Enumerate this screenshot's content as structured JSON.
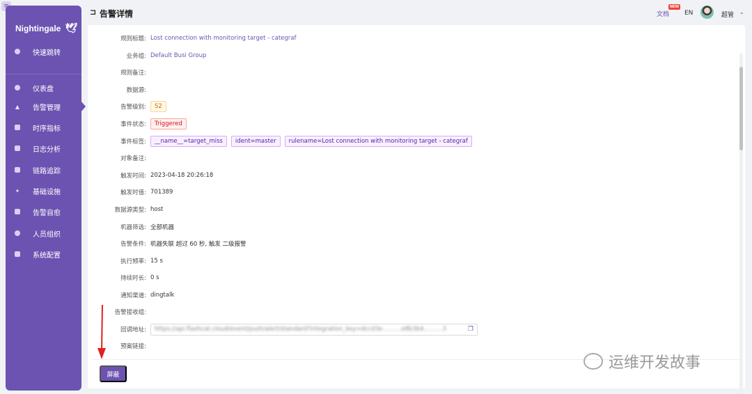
{
  "brand": {
    "name": "Nightingale"
  },
  "sidebar": {
    "items": [
      {
        "label": "快速跳转",
        "icon": "search-icon"
      },
      {
        "label": "仪表盘",
        "icon": "dashboard-icon"
      },
      {
        "label": "告警管理",
        "icon": "alarm-bell-icon",
        "active": true
      },
      {
        "label": "时序指标",
        "icon": "chart-icon"
      },
      {
        "label": "日志分析",
        "icon": "log-icon"
      },
      {
        "label": "链路追踪",
        "icon": "trace-icon"
      },
      {
        "label": "基础设施",
        "icon": "infrastructure-icon"
      },
      {
        "label": "告警自愈",
        "icon": "self-heal-icon"
      },
      {
        "label": "人员组织",
        "icon": "user-icon"
      },
      {
        "label": "系统配置",
        "icon": "settings-grid-icon"
      }
    ]
  },
  "header": {
    "title": "告警详情",
    "doc_link": "文档",
    "new_badge": "NEW",
    "lang": "EN",
    "username": "超管"
  },
  "details": {
    "rule_title": {
      "label": "规则标题:",
      "value": "Lost connection with monitoring target - categraf"
    },
    "business_group": {
      "label": "业务组:",
      "value": "Default Busi Group"
    },
    "rule_note": {
      "label": "规则备注:",
      "value": ""
    },
    "datasource": {
      "label": "数据源:",
      "value": ""
    },
    "severity": {
      "label": "告警级别:",
      "value": "S2"
    },
    "event_status": {
      "label": "事件状态:",
      "value": "Triggered"
    },
    "event_tags": {
      "label": "事件标签:",
      "values": [
        "__name__=target_miss",
        "ident=master",
        "rulename=Lost connection with monitoring target - categraf"
      ]
    },
    "target_note": {
      "label": "对象备注:",
      "value": ""
    },
    "trigger_time": {
      "label": "触发时间:",
      "value": "2023-04-18 20:26:18"
    },
    "trigger_value": {
      "label": "触发时值:",
      "value": "701389"
    },
    "datasource_type": {
      "label": "数据源类型:",
      "value": "host"
    },
    "machine_filter": {
      "label": "机器筛选:",
      "value": "全部机器"
    },
    "alert_condition": {
      "label": "告警条件:",
      "value": "机器失联 超过 60 秒, 触发 二级报警"
    },
    "exec_frequency": {
      "label": "执行频率:",
      "value": "15 s"
    },
    "duration": {
      "label": "持续时长:",
      "value": "0 s"
    },
    "notify_channel": {
      "label": "通知渠道:",
      "value": "dingtalk"
    },
    "receiver_group": {
      "label": "告警接收组:",
      "value": ""
    },
    "callback_url": {
      "label": "回调地址:",
      "value": "https://api.flashcat.cloud/event/push/alert/standard?integration_key=dccd3e..........e8b3b4..........3"
    },
    "runbook": {
      "label": "预案链接:",
      "value": ""
    }
  },
  "actions": {
    "mask_button": "屏蔽"
  },
  "watermark": {
    "text": "运维开发故事"
  }
}
